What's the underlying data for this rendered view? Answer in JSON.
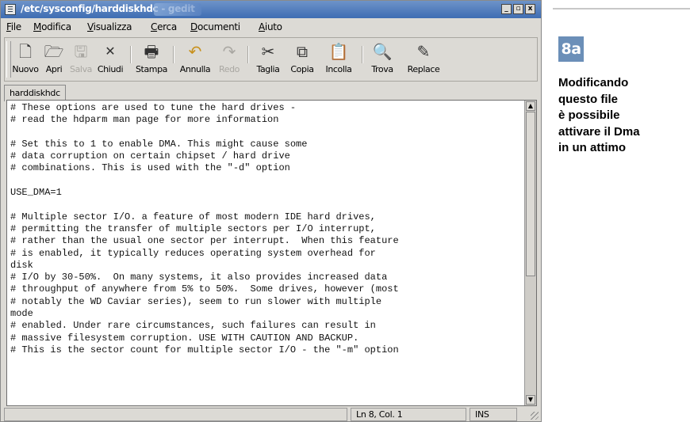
{
  "window": {
    "title": "/etc/sysconfig/harddiskhdc - gedit",
    "controls": [
      "_",
      "▫",
      "x"
    ]
  },
  "menubar": [
    {
      "label": "File",
      "u": "F",
      "rest": "ile"
    },
    {
      "label": "Modifica",
      "u": "M",
      "rest": "odifica"
    },
    {
      "label": "Visualizza",
      "u": "V",
      "rest": "isualizza"
    },
    {
      "label": "Cerca",
      "u": "C",
      "rest": "erca"
    },
    {
      "label": "Documenti",
      "u": "D",
      "rest": "ocumenti"
    },
    {
      "label": "Aiuto",
      "u": "A",
      "rest": "iuto"
    }
  ],
  "toolbar": {
    "new": "Nuovo",
    "open": "Apri",
    "save": "Salva",
    "close": "Chiudi",
    "print": "Stampa",
    "undo": "Annulla",
    "redo": "Redo",
    "cut": "Taglia",
    "copy": "Copia",
    "paste": "Incolla",
    "find": "Trova",
    "replace": "Replace"
  },
  "tab": {
    "label": "harddiskhdc"
  },
  "editor": {
    "lines": [
      "# These options are used to tune the hard drives -",
      "# read the hdparm man page for more information",
      "",
      "# Set this to 1 to enable DMA. This might cause some",
      "# data corruption on certain chipset / hard drive",
      "# combinations. This is used with the \"-d\" option",
      "",
      "USE_DMA=1",
      "",
      "# Multiple sector I/O. a feature of most modern IDE hard drives,",
      "# permitting the transfer of multiple sectors per I/O interrupt,",
      "# rather than the usual one sector per interrupt.  When this feature",
      "# is enabled, it typically reduces operating system overhead for",
      "disk",
      "# I/O by 30-50%.  On many systems, it also provides increased data",
      "# throughput of anywhere from 5% to 50%.  Some drives, however (most",
      "# notably the WD Caviar series), seem to run slower with multiple",
      "mode",
      "# enabled. Under rare circumstances, such failures can result in",
      "# massive filesystem corruption. USE WITH CAUTION AND BACKUP.",
      "# This is the sector count for multiple sector I/O - the \"-m\" option"
    ]
  },
  "status": {
    "position": "Ln 8, Col. 1",
    "mode": "INS"
  },
  "badge": "8a",
  "caption": [
    "Modificando",
    "questo file",
    "è possibile",
    "attivare il Dma",
    "in un attimo"
  ],
  "colors": {
    "titlebar": "#4f7cbf",
    "badge": "#6b8fb8",
    "window_bg": "#dcdad5"
  }
}
